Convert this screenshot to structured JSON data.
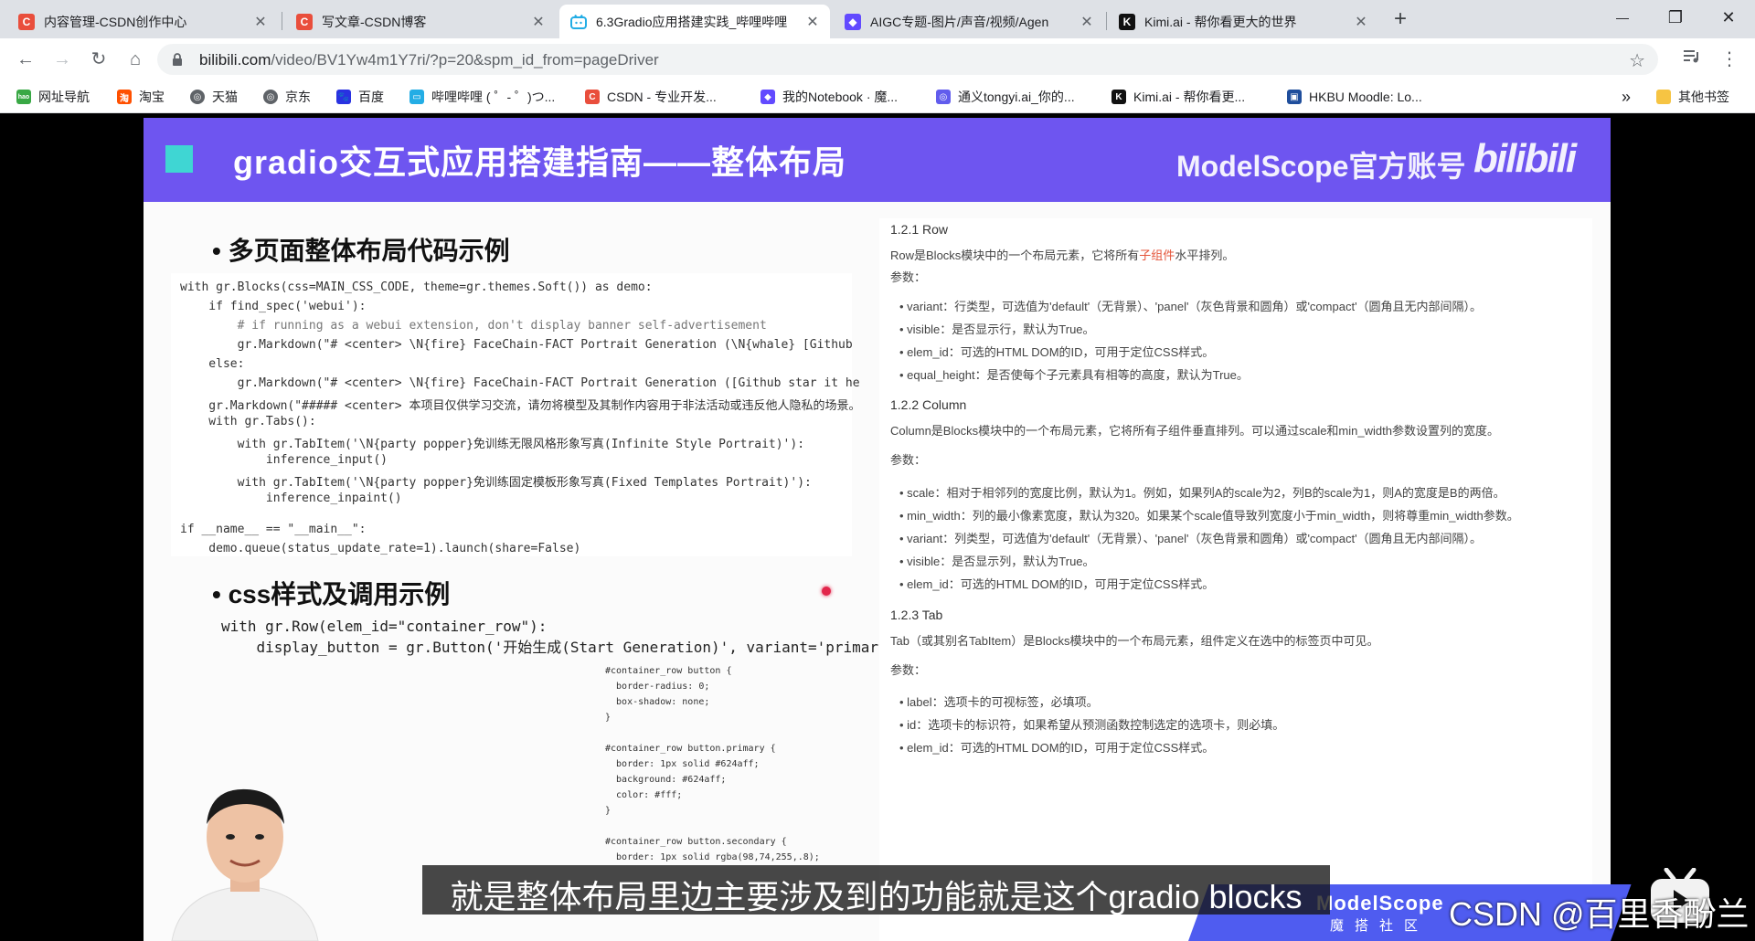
{
  "browser": {
    "tabs": [
      {
        "title": "内容管理-CSDN创作中心",
        "icon": "C",
        "icon_color": "#e94e3c",
        "active": false
      },
      {
        "title": "写文章-CSDN博客",
        "icon": "C",
        "icon_color": "#e94e3c",
        "active": false
      },
      {
        "title": "6.3Gradio应用搭建实践_哔哩哔哩",
        "icon": "tv",
        "icon_color": "#23ade5",
        "active": true
      },
      {
        "title": "AIGC专题-图片/声音/视频/Agen",
        "icon": "◆",
        "icon_color": "#624aff",
        "active": false
      },
      {
        "title": "Kimi.ai - 帮你看更大的世界",
        "icon": "K",
        "icon_color": "#111111",
        "active": false
      }
    ],
    "new_tab": "+",
    "window_controls": {
      "minimize": "—",
      "maximize": "❐",
      "close": "✕"
    },
    "toolbar": {
      "back": "←",
      "forward": "→",
      "reload": "↻",
      "home": "⌂",
      "url_host": "bilibili.com",
      "url_path": "/video/BV1Yw4m1Y7ri/?p=20&spm_id_from=pageDriver",
      "star": "☆"
    },
    "bookmarks": [
      {
        "label": "网址导航",
        "icon": "hao",
        "color": "#39a845"
      },
      {
        "label": "淘宝",
        "icon": "淘",
        "color": "#ff5000"
      },
      {
        "label": "天猫",
        "icon": "globe",
        "color": "#555555"
      },
      {
        "label": "京东",
        "icon": "globe",
        "color": "#555555"
      },
      {
        "label": "百度",
        "icon": "paw",
        "color": "#2932e1"
      },
      {
        "label": "哔哩哔哩 ( ゜- ゜)つ...",
        "icon": "tv",
        "color": "#23ade5"
      },
      {
        "label": "CSDN - 专业开发...",
        "icon": "C",
        "color": "#e94e3c"
      },
      {
        "label": "我的Notebook · 魔...",
        "icon": "◆",
        "color": "#624aff"
      },
      {
        "label": "通义tongyi.ai_你的...",
        "icon": "◎",
        "color": "#615ced"
      },
      {
        "label": "Kimi.ai - 帮你看更...",
        "icon": "K",
        "color": "#111111"
      },
      {
        "label": "HKBU Moodle: Lo...",
        "icon": "▣",
        "color": "#1f4e9c"
      }
    ],
    "bookmarks_more": "»",
    "other_bookmarks": "其他书签"
  },
  "slide": {
    "title": "gradio交互式应用搭建指南——整体布局",
    "brand": "ModelScope官方账号",
    "bili_logo": "bilibili",
    "section1": "• 多页面整体布局代码示例",
    "section2": "• css样式及调用示例",
    "code_lines": [
      "with gr.Blocks(css=MAIN_CSS_CODE, theme=gr.themes.Soft()) as demo:",
      "    if find_spec('webui'):",
      "        # if running as a webui extension, don't display banner self-advertisement",
      "        gr.Markdown(\"# <center> \\N{fire} FaceChain-FACT Portrait Generation (\\N{whale} [Github",
      "    else:",
      "        gr.Markdown(\"# <center> \\N{fire} FaceChain-FACT Portrait Generation ([Github star it he",
      "    gr.Markdown(\"##### <center> 本项目仅供学习交流，请勿将模型及其制作内容用于非法活动或违反他人隐私的场景。",
      "    with gr.Tabs():",
      "        with gr.TabItem('\\N{party popper}免训练无限风格形象写真(Infinite Style Portrait)'):",
      "            inference_input()",
      "        with gr.TabItem('\\N{party popper}免训练固定模板形象写真(Fixed Templates Portrait)'):",
      "            inference_inpaint()",
      "",
      "if __name__ == \"__main__\":",
      "    demo.queue(status_update_rate=1).launch(share=False)"
    ],
    "css_call_line1": "with gr.Row(elem_id=\"container_row\"):",
    "css_call_line2": "    display_button = gr.Button('开始生成(Start Generation)', variant='primary')",
    "css_snippet": "#container_row button {\n  border-radius: 0;\n  box-shadow: none;\n}\n\n#container_row button.primary {\n  border: 1px solid #624aff;\n  background: #624aff;\n  color: #fff;\n}\n\n#container_row button.secondary {\n  border: 1px solid rgba(98,74,255,.8);",
    "doc": {
      "row_heading": "1.2.1 Row",
      "row_desc_pre": "Row是Blocks模块中的一个布局元素，它将所有",
      "row_desc_link": "子组件",
      "row_desc_post": "水平排列。",
      "params": "参数：",
      "row_params": [
        "• variant：行类型，可选值为'default'（无背景）、'panel'（灰色背景和圆角）或'compact'（圆角且无内部间隔）。",
        "• visible：是否显示行，默认为True。",
        "• elem_id：可选的HTML DOM的ID，可用于定位CSS样式。",
        "• equal_height：是否使每个子元素具有相等的高度，默认为True。"
      ],
      "col_heading": "1.2.2 Column",
      "col_desc": "Column是Blocks模块中的一个布局元素，它将所有子组件垂直排列。可以通过scale和min_width参数设置列的宽度。",
      "col_params": [
        "• scale：相对于相邻列的宽度比例，默认为1。例如，如果列A的scale为2，列B的scale为1，则A的宽度是B的两倍。",
        "• min_width：列的最小像素宽度，默认为320。如果某个scale值导致列宽度小于min_width，则将尊重min_width参数。",
        "• variant：列类型，可选值为'default'（无背景）、'panel'（灰色背景和圆角）或'compact'（圆角且无内部间隔）。",
        "• visible：是否显示列，默认为True。",
        "• elem_id：可选的HTML DOM的ID，可用于定位CSS样式。"
      ],
      "tab_heading": "1.2.3 Tab",
      "tab_desc": "Tab（或其别名TabItem）是Blocks模块中的一个布局元素，组件定义在选中的标签页中可见。",
      "tab_params": [
        "• label：选项卡的可视标签，必填项。",
        "• id：选项卡的标识符，如果希望从预测函数控制选定的选项卡，则必填。",
        "• elem_id：可选的HTML DOM的ID，可用于定位CSS样式。"
      ]
    },
    "subtitle": "就是整体布局里边主要涉及到的功能就是这个gradio blocks",
    "footer_brand": "ModelScope",
    "footer_brand_sub": "魔搭社区",
    "watermark": "CSDN @百里香酚兰"
  }
}
